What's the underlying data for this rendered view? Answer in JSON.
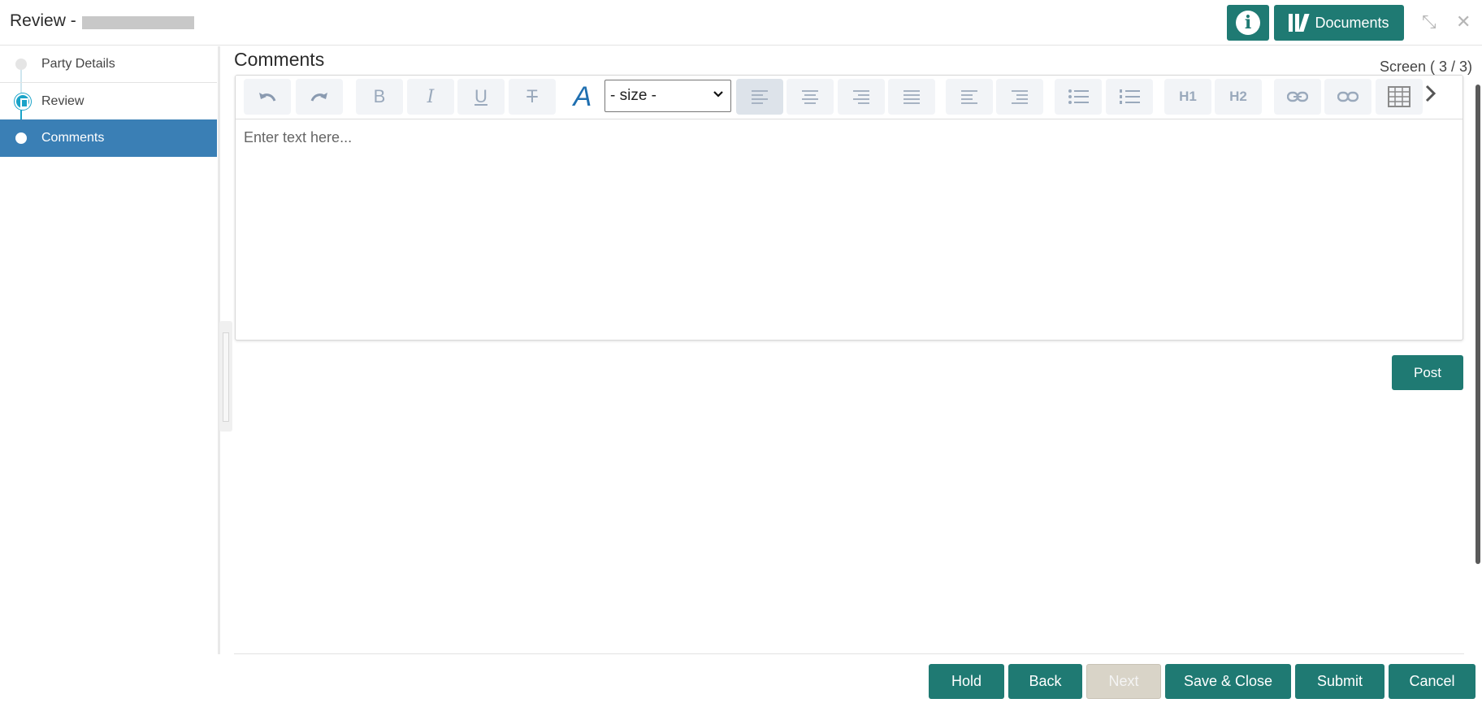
{
  "header": {
    "title": "Review - ",
    "documents_label": "Documents",
    "info_glyph": "i",
    "minimize_glyph": "⤡",
    "close_glyph": "✕"
  },
  "sidebar": {
    "steps": [
      {
        "label": "Party Details",
        "state": "pending"
      },
      {
        "label": "Review",
        "state": "in-progress"
      },
      {
        "label": "Comments",
        "state": "active"
      }
    ]
  },
  "main": {
    "section_title": "Comments",
    "screen_indicator": "Screen ( 3 / 3)",
    "editor": {
      "placeholder": "Enter text here...",
      "size_select_value": "- size -",
      "toolbar_labels": {
        "bold": "B",
        "italic": "I",
        "underline": "U",
        "strike": "T",
        "font_color": "A",
        "h1": "H1",
        "h2": "H2"
      },
      "toolbar_icons": [
        "undo-icon",
        "redo-icon",
        "bold-icon",
        "italic-icon",
        "underline-icon",
        "strikethrough-icon",
        "font-color-icon",
        "align-left-icon",
        "align-center-icon",
        "align-right-icon",
        "align-justify-icon",
        "indent-icon",
        "outdent-icon",
        "bullet-list-icon",
        "numbered-list-icon",
        "heading1-icon",
        "heading2-icon",
        "link-icon",
        "unlink-icon",
        "table-icon",
        "chevron-right-icon"
      ]
    },
    "post_label": "Post"
  },
  "footer": {
    "hold": "Hold",
    "back": "Back",
    "next": "Next",
    "save_close": "Save & Close",
    "submit": "Submit",
    "cancel": "Cancel"
  },
  "colors": {
    "primary": "#1f7a73",
    "active_step": "#3a7fb5",
    "progress_step": "#1aa3c8",
    "disabled": "#d9d4c8"
  }
}
